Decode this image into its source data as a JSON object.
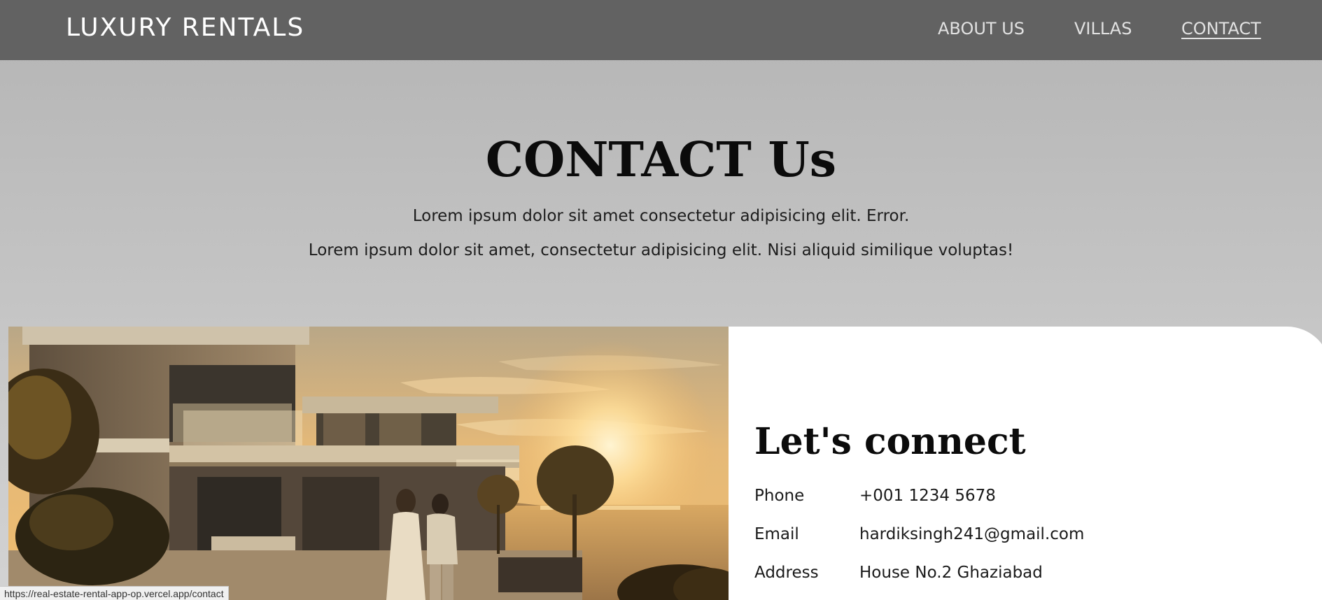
{
  "header": {
    "brand": "LUXURY RENTALS",
    "nav": {
      "about": "ABOUT US",
      "villas": "VILLAS",
      "contact": "CONTACT"
    },
    "active_item": "CONTACT"
  },
  "hero": {
    "title": "CONTACT Us",
    "line1": "Lorem ipsum dolor sit amet consectetur adipisicing elit. Error.",
    "line2": "Lorem ipsum dolor sit amet, consectetur adipisicing elit. Nisi aliquid similique voluptas!"
  },
  "contact": {
    "heading": "Let's connect",
    "phone_label": "Phone",
    "phone_value": "+001 1234 5678",
    "email_label": "Email",
    "email_value": "hardiksingh241@gmail.com",
    "address_label": "Address",
    "address_value": "House No.2 Ghaziabad"
  },
  "status_bar": {
    "url": "https://real-estate-rental-app-op.vercel.app/contact"
  },
  "colors": {
    "navbar": "#626262",
    "nav_text": "#e2e2e2",
    "brand_text": "#ffffff",
    "card": "#ffffff",
    "heading": "#0b0b0b"
  },
  "image": {
    "icon": "villa-sunset-photo"
  }
}
